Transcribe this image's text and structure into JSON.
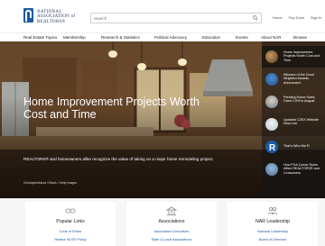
{
  "header": {
    "logo_lines": [
      "NATIONAL",
      "ASSOCIATION of",
      "REALTORS®"
    ],
    "search_placeholder": "Search",
    "util_links": [
      "Home",
      "Pay Dues",
      "Sign In"
    ]
  },
  "nav": {
    "items": [
      "Real Estate Topics",
      "Membership",
      "Research & Statistics",
      "Political Advocacy",
      "Education",
      "Events",
      "About NAR",
      "Browse"
    ]
  },
  "hero": {
    "title": "Home Improvement Projects Worth Cost and Time",
    "description": "REALTORS® and homeowners alike recognize the value of taking on a major home remodeling project.",
    "credit": "Christopherkinda / iStock / Getty Images"
  },
  "sidebar": {
    "items": [
      {
        "label": "Home Improvement Projects Worth Cost and Time"
      },
      {
        "label": "Winners of the Good Neighbor Awards Announced"
      },
      {
        "label": "Pending Home Sales Grew 1.5% in August"
      },
      {
        "label": "Updated C2EX Website Now Live"
      },
      {
        "label": "That's Who We R"
      },
      {
        "label": "How FHA Condo Rules Affect REALTORS® and Consumers"
      }
    ]
  },
  "cards": [
    {
      "title": "Popular Links",
      "links": [
        "Code of Ethics",
        "Realtor MLS® Policy"
      ],
      "icon": "link-icon"
    },
    {
      "title": "Associations",
      "links": [
        "Association Executives",
        "State & Local Associations"
      ],
      "icon": "building-icon"
    },
    {
      "title": "NAR Leadership",
      "links": [
        "National Leadership",
        "Board of Directors"
      ],
      "icon": "people-icon"
    }
  ],
  "colors": {
    "brand": "#1d5ba4",
    "header_bg": "#ffffff",
    "sidebar_bg": "#222222"
  }
}
